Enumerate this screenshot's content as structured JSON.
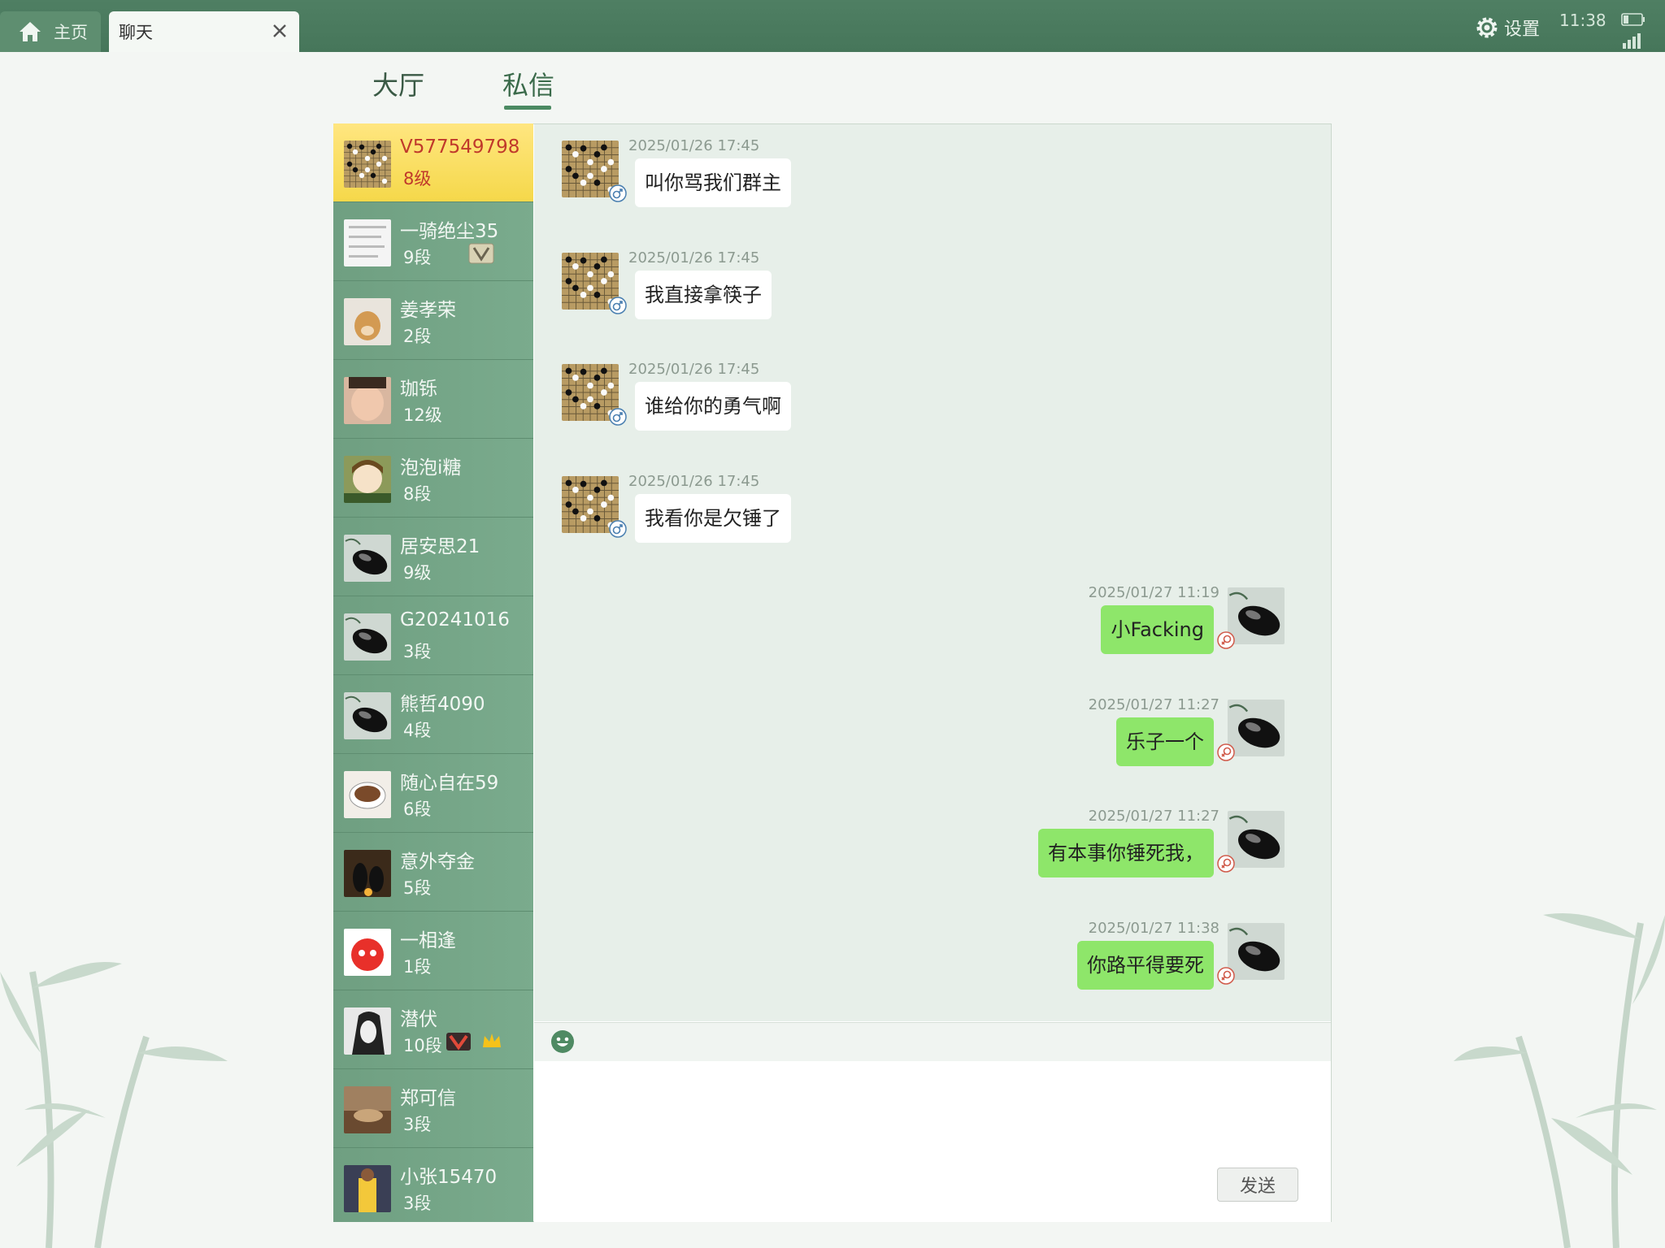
{
  "tabs": {
    "home_label": "主页",
    "chat_label": "聊天"
  },
  "status": {
    "settings_label": "设置",
    "time": "11:38"
  },
  "segments": {
    "hall": "大厅",
    "private": "私信"
  },
  "contacts": [
    {
      "name": "V577549798",
      "rank": "8级",
      "active": true,
      "avatar": "go-board"
    },
    {
      "name": "一骑绝尘35",
      "rank": "9段",
      "avatar": "screenshot",
      "badge": "vip-badge"
    },
    {
      "name": "姜孝荣",
      "rank": "2段",
      "avatar": "dog"
    },
    {
      "name": "珈铄",
      "rank": "12级",
      "avatar": "child-face"
    },
    {
      "name": "泡泡i糖",
      "rank": "8段",
      "avatar": "anime"
    },
    {
      "name": "居安思21",
      "rank": "9级",
      "avatar": "go-stone"
    },
    {
      "name": "G20241016",
      "rank": "3段",
      "avatar": "go-stone"
    },
    {
      "name": "熊哲4090",
      "rank": "4段",
      "avatar": "go-stone"
    },
    {
      "name": "随心自在59",
      "rank": "6段",
      "avatar": "coffee"
    },
    {
      "name": "意外夺金",
      "rank": "5段",
      "avatar": "penguins"
    },
    {
      "name": "一相逢",
      "rank": "1段",
      "avatar": "red-mascot"
    },
    {
      "name": "潜伏",
      "rank": "10段",
      "avatar": "sketch-face",
      "badge": "medal-and-crown"
    },
    {
      "name": "郑可信",
      "rank": "3段",
      "avatar": "cat"
    },
    {
      "name": "小张15470",
      "rank": "3段",
      "avatar": "player"
    }
  ],
  "messages": [
    {
      "side": "left",
      "time": "2025/01/26 17:45",
      "text": "叫你骂我们群主"
    },
    {
      "side": "left",
      "time": "2025/01/26 17:45",
      "text": "我直接拿筷子"
    },
    {
      "side": "left",
      "time": "2025/01/26 17:45",
      "text": "谁给你的勇气啊"
    },
    {
      "side": "left",
      "time": "2025/01/26 17:45",
      "text": "我看你是欠锤了"
    },
    {
      "side": "right",
      "time": "2025/01/27 11:19",
      "text": "小Facking"
    },
    {
      "side": "right",
      "time": "2025/01/27 11:27",
      "text": "乐子一个"
    },
    {
      "side": "right",
      "time": "2025/01/27 11:27",
      "text": "有本事你锤死我，"
    },
    {
      "side": "right",
      "time": "2025/01/27 11:38",
      "text": "你路平得要死"
    }
  ],
  "composer": {
    "send_label": "发送"
  },
  "colors": {
    "topbar": "#4f7f63",
    "contact_bg": "#6f9f81",
    "active_contact": "#f5d84a",
    "self_bubble": "#8ee66a",
    "chat_bg": "#e7efe9"
  }
}
